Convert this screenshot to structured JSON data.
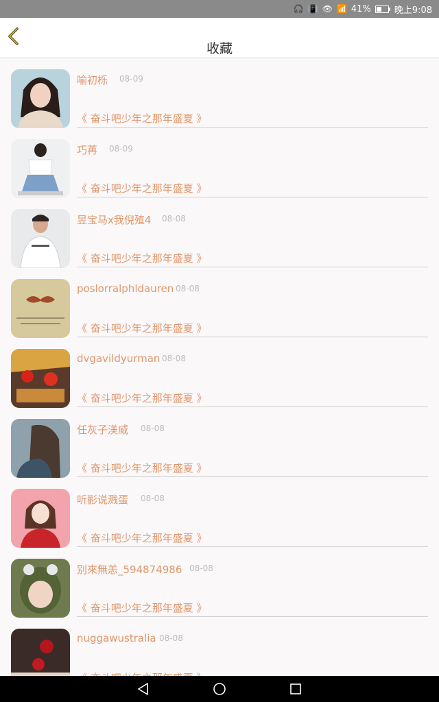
{
  "status_bar": {
    "battery": "41%",
    "battery_level": 0.41,
    "time": "晚上9:08"
  },
  "header": {
    "title": "收藏",
    "back_icon": "chevron-left-icon",
    "accent": "#e6b800"
  },
  "colors": {
    "accent_text": "#e0966a",
    "date_text": "#bdbdbd",
    "title_text": "#333333"
  },
  "favorites": [
    {
      "name": "喻初栎",
      "date": "08-09",
      "work": "《 奋斗吧少年之那年盛夏 》"
    },
    {
      "name": "巧苒",
      "date": "08-09",
      "work": "《 奋斗吧少年之那年盛夏 》"
    },
    {
      "name": "昱宝马x我倪殖4",
      "date": "08-08",
      "work": "《 奋斗吧少年之那年盛夏 》"
    },
    {
      "name": "poslorralphldauren",
      "date": "08-08",
      "work": "《 奋斗吧少年之那年盛夏 》"
    },
    {
      "name": "dvgavildyurman",
      "date": "08-08",
      "work": "《 奋斗吧少年之那年盛夏 》"
    },
    {
      "name": "任灰子渼威",
      "date": "08-08",
      "work": "《 奋斗吧少年之那年盛夏 》"
    },
    {
      "name": "听彨说溅蛋",
      "date": "08-08",
      "work": "《 奋斗吧少年之那年盛夏 》"
    },
    {
      "name": "别來無恙_594874986",
      "date": "08-08",
      "work": "《 奋斗吧少年之那年盛夏 》"
    },
    {
      "name": "nuggawustralia",
      "date": "08-08",
      "work": "《 奋斗吧少年之那年盛夏 》"
    }
  ],
  "nav_bar": {
    "back_icon": "triangle-back-icon",
    "home_icon": "circle-home-icon",
    "recents_icon": "square-recents-icon"
  }
}
